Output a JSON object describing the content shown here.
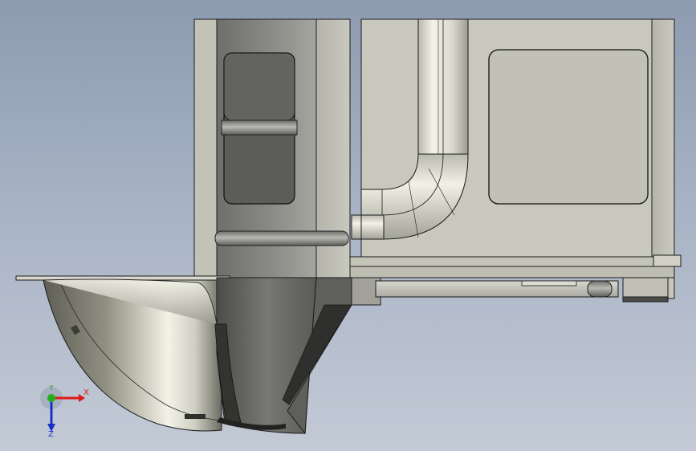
{
  "viewport": {
    "background_top": "#8d9bb0",
    "background_bottom": "#c3cad6"
  },
  "model": {
    "body_color": "#c6c6bb",
    "shadow_color": "#6d6d69",
    "edge_color": "#1b1b1b"
  },
  "triad": {
    "x_label": "X",
    "y_label": "Y",
    "z_label": "Z",
    "x_color": "#e01818",
    "y_color": "#1fb01f",
    "z_color": "#1a2fc8"
  }
}
